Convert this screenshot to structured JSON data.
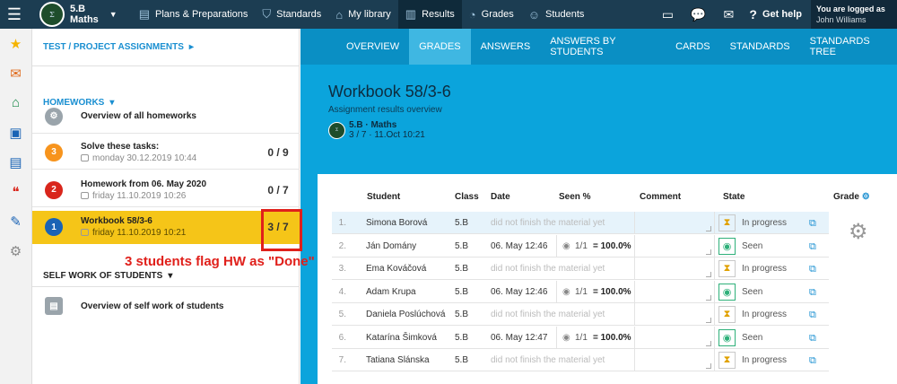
{
  "topbar": {
    "menu_icon": "hamburger-icon",
    "class": {
      "line1": "5.B",
      "line2": "Maths",
      "avatar_text": "Σ"
    },
    "nav": [
      {
        "label": "Plans & Preparations",
        "icon": "clipboard-icon"
      },
      {
        "label": "Standards",
        "icon": "shield-icon"
      },
      {
        "label": "My library",
        "icon": "library-icon"
      },
      {
        "label": "Results",
        "icon": "chart-icon"
      },
      {
        "label": "Grades",
        "icon": "grades-icon"
      },
      {
        "label": "Students",
        "icon": "students-icon"
      }
    ],
    "help_label": "Get help",
    "logged_label": "You are logged as",
    "user_name": "John Williams"
  },
  "left": {
    "test_link": "TEST / PROJECT ASSIGNMENTS",
    "homeworks_link": "HOMEWORKS",
    "overview_label": "Overview of all homeworks",
    "homeworks": [
      {
        "badge": "3",
        "color": "#f7941d",
        "title": "Solve these tasks:",
        "sub": "monday 30.12.2019 10:44",
        "count": "0 / 9"
      },
      {
        "badge": "2",
        "color": "#d9261c",
        "title": "Homework from 06. May 2020",
        "sub": "friday 11.10.2019 10:26",
        "count": "0 / 7"
      },
      {
        "badge": "1",
        "color": "#1a63b5",
        "title": "Workbook 58/3-6",
        "sub": "friday 11.10.2019 10:21",
        "count": "3 / 7"
      }
    ],
    "self_work_link": "SELF WORK OF STUDENTS",
    "self_overview_label": "Overview of self work of students",
    "annotation": "3 students flag HW as \"Done\""
  },
  "right": {
    "tabs": [
      "OVERVIEW",
      "GRADES",
      "ANSWERS",
      "ANSWERS BY STUDENTS",
      "CARDS",
      "STANDARDS",
      "STANDARDS TREE"
    ],
    "title": "Workbook 58/3-6",
    "subtitle": "Assignment results overview",
    "class_name": "5.B · Maths",
    "class_meta": "3 / 7 · 11.Oct 10:21",
    "columns": {
      "student": "Student",
      "class": "Class",
      "date": "Date",
      "seen": "Seen %",
      "comment": "Comment",
      "state": "State",
      "grade": "Grade"
    },
    "rows": [
      {
        "num": "1.",
        "name": "Simona Borová",
        "class": "5.B",
        "date": "did not finish the material yet",
        "done": false,
        "state": "In progress"
      },
      {
        "num": "2.",
        "name": "Ján Domány",
        "class": "5.B",
        "date": "06. May 12:46",
        "done": true,
        "frac": "1/1",
        "pct": "= 100.0%",
        "state": "Seen"
      },
      {
        "num": "3.",
        "name": "Ema Kováčová",
        "class": "5.B",
        "date": "did not finish the material yet",
        "done": false,
        "state": "In progress"
      },
      {
        "num": "4.",
        "name": "Adam Krupa",
        "class": "5.B",
        "date": "06. May 12:46",
        "done": true,
        "frac": "1/1",
        "pct": "= 100.0%",
        "state": "Seen"
      },
      {
        "num": "5.",
        "name": "Daniela Poslúchová",
        "class": "5.B",
        "date": "did not finish the material yet",
        "done": false,
        "state": "In progress"
      },
      {
        "num": "6.",
        "name": "Katarína Šimková",
        "class": "5.B",
        "date": "06. May 12:47",
        "done": true,
        "frac": "1/1",
        "pct": "= 100.0%",
        "state": "Seen"
      },
      {
        "num": "7.",
        "name": "Tatiana Slánska",
        "class": "5.B",
        "date": "did not finish the material yet",
        "done": false,
        "state": "In progress"
      }
    ]
  },
  "colors": {
    "topbar": "#1c3d52",
    "accent": "#0ba4dc",
    "selected": "#f5c518",
    "annotation": "#e0201b",
    "link": "#1a8fd1"
  }
}
